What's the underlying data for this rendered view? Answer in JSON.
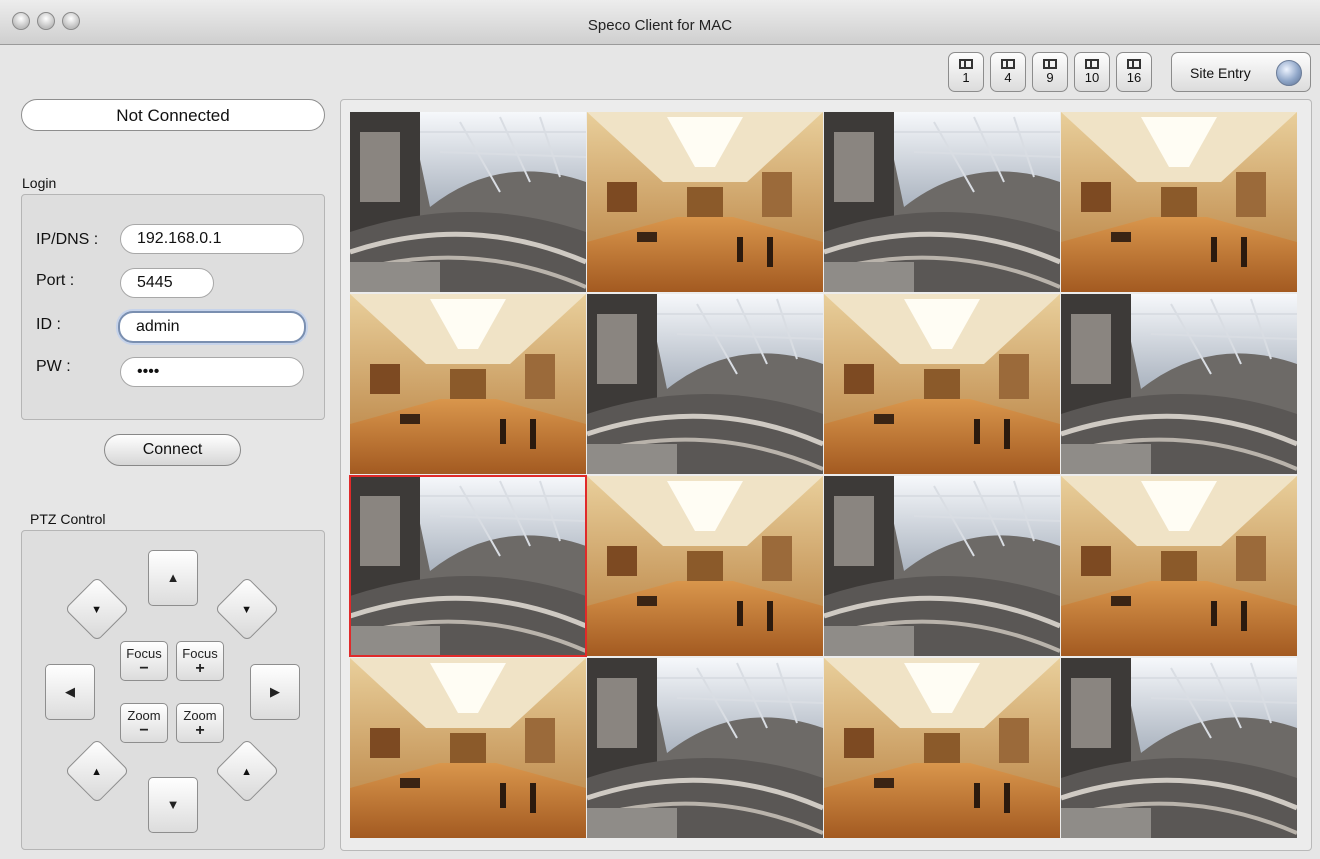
{
  "window": {
    "title": "Speco Client for MAC"
  },
  "toolbar": {
    "split_buttons": [
      "1",
      "4",
      "9",
      "10",
      "16"
    ],
    "site_entry_label": "Site Entry"
  },
  "status": {
    "text": "Not Connected"
  },
  "login": {
    "section_label": "Login",
    "ip_label": "IP/DNS :",
    "ip_value": "192.168.0.1",
    "port_label": "Port :",
    "port_value": "5445",
    "id_label": "ID :",
    "id_value": "admin",
    "pw_label": "PW :",
    "pw_value": "••••",
    "connect_label": "Connect"
  },
  "ptz": {
    "section_label": "PTZ Control",
    "focus_minus": "Focus",
    "focus_plus": "Focus",
    "zoom_minus": "Zoom",
    "zoom_plus": "Zoom",
    "minus_sign": "−",
    "plus_sign": "+",
    "arrow_up": "▲",
    "arrow_down": "▼",
    "arrow_left": "◀",
    "arrow_right": "▶"
  },
  "video_grid": {
    "rows": 4,
    "cols": 4,
    "selected_index": 8,
    "scenes": [
      "mall",
      "gallery",
      "mall",
      "gallery",
      "gallery",
      "mall",
      "gallery",
      "mall",
      "mall",
      "gallery",
      "mall",
      "gallery",
      "gallery",
      "mall",
      "gallery",
      "mall"
    ]
  },
  "colors": {
    "selection": "#e02a2a",
    "panel": "#e6e6e6"
  }
}
